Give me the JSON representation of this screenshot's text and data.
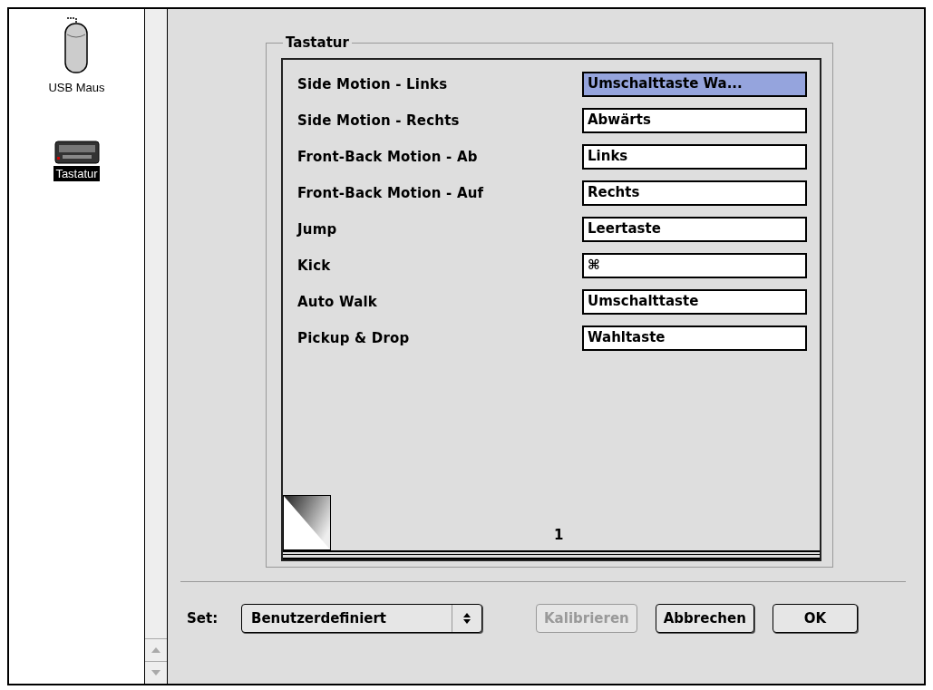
{
  "sidebar": {
    "items": [
      {
        "label": "USB Maus",
        "kind": "mouse",
        "selected": false
      },
      {
        "label": "Tastatur",
        "kind": "keyboard",
        "selected": true
      }
    ]
  },
  "group": {
    "title": "Tastatur",
    "rows": [
      {
        "label": "Side Motion - Links",
        "value": "Umschalttaste Wa...",
        "selected": true
      },
      {
        "label": "Side Motion - Rechts",
        "value": "Abwärts",
        "selected": false
      },
      {
        "label": "Front-Back Motion - Ab",
        "value": "Links",
        "selected": false
      },
      {
        "label": "Front-Back Motion - Auf",
        "value": "Rechts",
        "selected": false
      },
      {
        "label": "Jump",
        "value": "Leertaste",
        "selected": false
      },
      {
        "label": "Kick",
        "value": "⌘",
        "selected": false
      },
      {
        "label": "Auto Walk",
        "value": "Umschalttaste",
        "selected": false
      },
      {
        "label": "Pickup & Drop",
        "value": "Wahltaste",
        "selected": false
      }
    ],
    "page": "1"
  },
  "footer": {
    "set_label": "Set:",
    "set_value": "Benutzerdefiniert",
    "buttons": [
      {
        "label": "Kalibrieren",
        "disabled": true
      },
      {
        "label": "Abbrechen",
        "disabled": false
      },
      {
        "label": "OK",
        "disabled": false
      }
    ]
  }
}
